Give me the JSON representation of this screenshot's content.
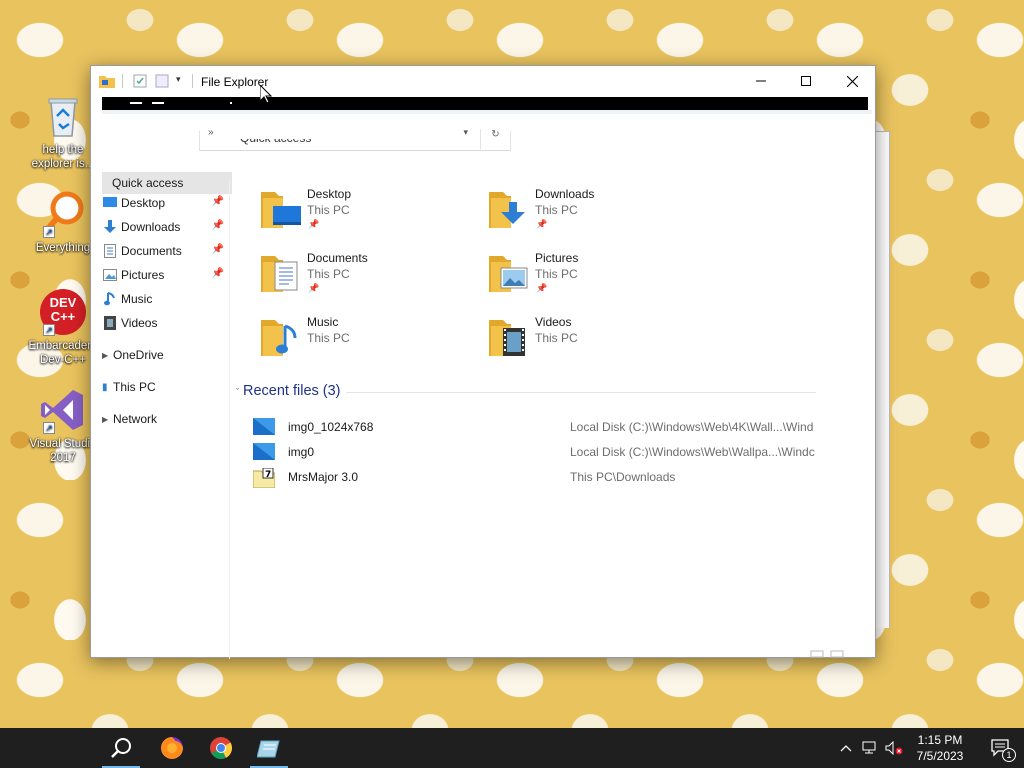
{
  "desktop": {
    "icons": [
      {
        "label": "help the explorer is...",
        "icon": "recycle-bin-icon"
      },
      {
        "label": "Everything",
        "icon": "everything-search-icon"
      },
      {
        "label": "Embarcadero Dev-C++",
        "icon": "devcpp-icon",
        "badge": "DEV C++"
      },
      {
        "label": "Visual Studio 2017",
        "icon": "visual-studio-icon"
      }
    ]
  },
  "window": {
    "title": "File Explorer",
    "address": "Quick access",
    "controls": {
      "minimize": "minimize-icon",
      "maximize": "maximize-icon",
      "close": "close-icon"
    }
  },
  "nav": {
    "items": [
      {
        "label": "Quick access",
        "type": "header"
      },
      {
        "label": "Desktop",
        "pinned": true
      },
      {
        "label": "Downloads",
        "pinned": true
      },
      {
        "label": "Documents",
        "pinned": true
      },
      {
        "label": "Pictures",
        "pinned": true
      },
      {
        "label": "Music"
      },
      {
        "label": "Videos"
      },
      {
        "label": "OneDrive"
      },
      {
        "label": "This PC"
      },
      {
        "label": "Network"
      }
    ]
  },
  "folders": [
    {
      "name": "Desktop",
      "location": "This PC",
      "pinned": true
    },
    {
      "name": "Downloads",
      "location": "This PC",
      "pinned": true
    },
    {
      "name": "Documents",
      "location": "This PC",
      "pinned": true
    },
    {
      "name": "Pictures",
      "location": "This PC",
      "pinned": true
    },
    {
      "name": "Music",
      "location": "This PC",
      "pinned": false
    },
    {
      "name": "Videos",
      "location": "This PC",
      "pinned": false
    }
  ],
  "recent": {
    "heading": "Recent files (3)",
    "files": [
      {
        "name": "img0_1024x768",
        "path": "Local Disk (C:)\\Windows\\Web\\4K\\Wall...\\Wind"
      },
      {
        "name": "img0",
        "path": "Local Disk (C:)\\Windows\\Web\\Wallpa...\\Windc"
      },
      {
        "name": "MrsMajor 3.0",
        "path": "This PC\\Downloads"
      }
    ]
  },
  "taskbar": {
    "time": "1:15 PM",
    "date": "7/5/2023",
    "notification_count": "1",
    "apps": [
      "search-icon",
      "firefox-icon",
      "chrome-icon",
      "file-explorer-icon"
    ]
  },
  "colors": {
    "accent_blue": "#1e3287",
    "folder_yellow": "#f3c24a",
    "taskbar": "#1f1f1f"
  }
}
